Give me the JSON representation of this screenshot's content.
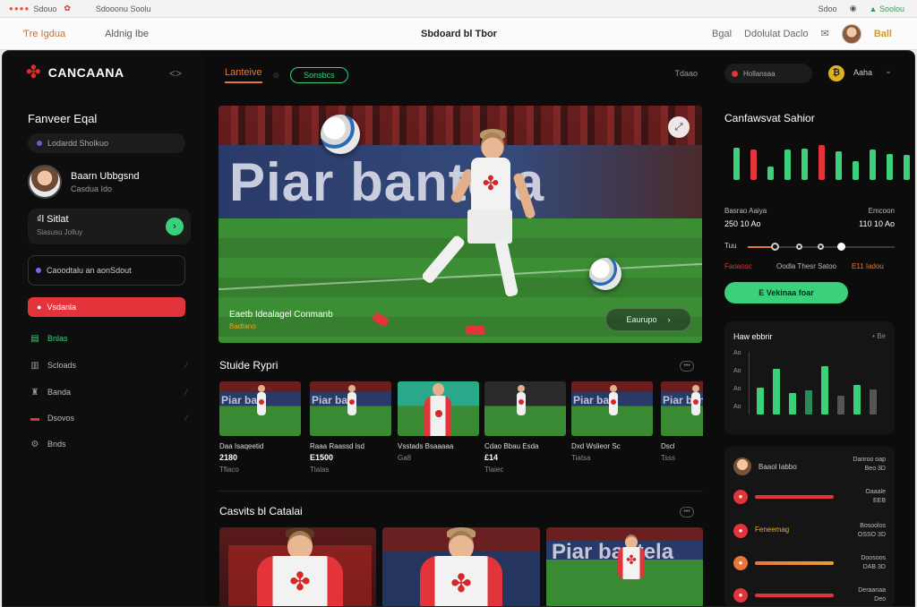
{
  "os_bar": {
    "dots": "●●●●",
    "title": "Sdouo",
    "menu": "Sdooonu Soolu",
    "right_1": "Sdoo",
    "right_2": "Soolou"
  },
  "top_nav": {
    "brand": "Ƭre Igdua",
    "item": "Aldnig Ibe",
    "center_title": "Sbdoard bl Tbor",
    "right_1": "Bgal",
    "right_2": "Ddolulat Daclo",
    "tag": "Ball"
  },
  "sidebar": {
    "logo": "CANCAANA",
    "heading": "Fanveer Eqal",
    "search_placeholder": "Lodardd Sholkuo",
    "profile_name": "Baarn Ubbgsnd",
    "profile_sub": "Casdua Ido",
    "balance_value": "₫l Sitlat",
    "balance_sub": "Siasusu Jolluy",
    "connect_label": "Caoodtalu an aonSdout",
    "active_item": "Vsdanla",
    "items": [
      {
        "label": "Bnlas"
      },
      {
        "label": "Scloads"
      },
      {
        "label": "Banda"
      },
      {
        "label": "Dsovos"
      },
      {
        "label": "Bnds"
      }
    ]
  },
  "main": {
    "tab_live": "Lanteive",
    "tab_pill": "Sonsbcs",
    "tabs_right": "Tdaao",
    "hero": {
      "board_text": "Piar bantela",
      "caption": "Eaetb Idealagel Conmanb",
      "caption_sub": "Badtano",
      "cta": "Eaurupo"
    },
    "section1_title": "Stuide Rypri",
    "thumbs": [
      {
        "title": "Daa Isaqeetid",
        "value": "2180",
        "sub": "Tflaco"
      },
      {
        "title": "Raaa Raassd lsd",
        "value": "E1500",
        "sub": "Tlalas"
      },
      {
        "title": "Vsstads Bsaaaaa",
        "value": "",
        "sub": "Ga8"
      },
      {
        "title": "Cdao Bbau Esda",
        "value": "£14",
        "sub": "Tlaiec"
      },
      {
        "title": "Dxd Wslieor Sc",
        "value": "",
        "sub": "Tiatsa"
      },
      {
        "title": "Dscl",
        "value": "",
        "sub": "Tsss"
      }
    ],
    "thumb_board_text": "Piar ban",
    "section2_title": "Casvits bl Catalai",
    "card_board_text": "Piar bantela"
  },
  "right_panel": {
    "search_label": "Hollansaa",
    "account_label": "Aaha",
    "coin_symbol": "₿",
    "stats_title": "Canfawsvat Sahior",
    "left_stat_label": "Basrao  Aaiya",
    "left_stat_value": "250  10 Ao",
    "right_stat_label": "Emcoon",
    "right_stat_value": "110  10 Ao",
    "slider_label": "Tuu",
    "legend_a": "Faoaosc",
    "legend_b": "Oodla Thesr Satoo",
    "legend_c": "E11 Iadou",
    "green_button": "E Vekinaa foar",
    "chart_title": "Haw ebbrir",
    "chart_option": "Be",
    "chart_y_labels": [
      "Ao",
      "Ao",
      "Ao",
      "Ao"
    ],
    "rank_head_name": "Baaol Iabbo",
    "rank_head_right": [
      "Danroo oap",
      "Beo 3D"
    ],
    "ranks": [
      {
        "label": "",
        "right": [
          "Oaaale",
          "EEB"
        ],
        "color": "#e2343a"
      },
      {
        "label": "Feneemag",
        "right": [
          "Bosoolos",
          "OSSO 3D"
        ],
        "color": "#e8783a"
      },
      {
        "label": "",
        "right": [
          "Doosoos",
          "DAB 3D"
        ],
        "color": "#e8a030"
      },
      {
        "label": "",
        "right": [
          "Deraanaa",
          "Deo"
        ],
        "color": "#e2343a"
      }
    ]
  },
  "chart_data": {
    "type": "bar",
    "title": "Haw ebbrir",
    "series": [
      {
        "values": [
          0.55,
          0.95,
          0.45,
          0.5,
          1.0,
          0.38,
          0.62,
          0.52
        ]
      }
    ],
    "top_series": [
      {
        "values": [
          0.52,
          0.48,
          0.22,
          0.48,
          0.5,
          0.55,
          0.45,
          0.3,
          0.48,
          0.42,
          0.4
        ]
      }
    ],
    "grid": false
  }
}
